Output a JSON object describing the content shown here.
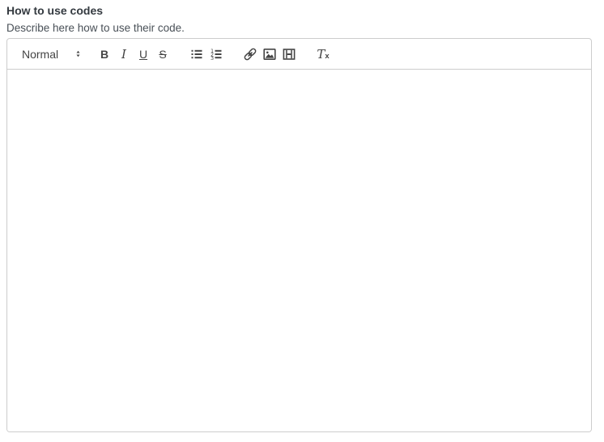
{
  "field": {
    "label": "How to use codes",
    "description": "Describe here how to use their code."
  },
  "editor": {
    "toolbar": {
      "format_picker": {
        "selected": "Normal",
        "expand_icon": "chevron-up-down-icon"
      },
      "bold_label": "B",
      "italic_label": "I",
      "underline_label": "U",
      "strike_label": "S",
      "clean_label_t": "T",
      "clean_label_x": "x",
      "icons": {
        "list_bullet": "list-bullet-icon",
        "list_ordered": "list-ordered-icon",
        "link": "link-icon",
        "image": "image-icon",
        "video": "video-icon",
        "clean": "clean-format-icon"
      }
    },
    "content": {
      "value": ""
    }
  },
  "colors": {
    "border": "#cccccc",
    "icon": "#444444",
    "label_text": "#343a40",
    "description_text": "#495057",
    "background": "#ffffff"
  }
}
